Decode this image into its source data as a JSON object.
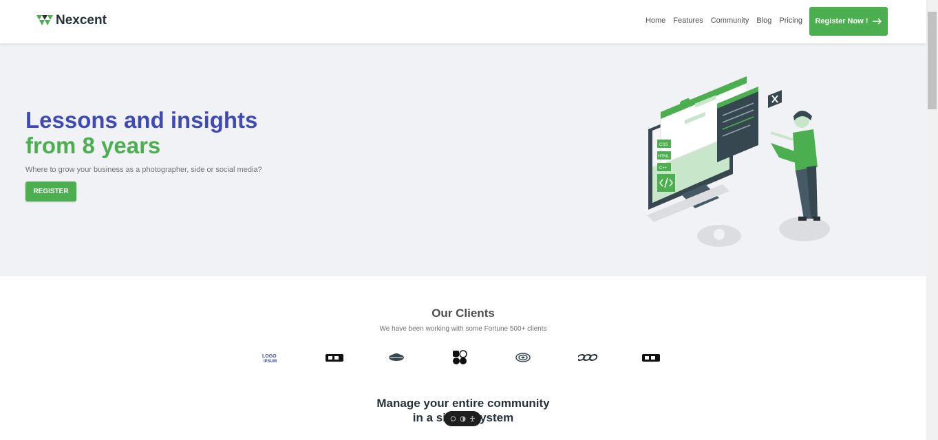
{
  "header": {
    "brand": "Nexcent",
    "nav": [
      {
        "label": "Home"
      },
      {
        "label": "Features"
      },
      {
        "label": "Community"
      },
      {
        "label": "Blog"
      },
      {
        "label": "Pricing"
      }
    ],
    "cta_label": "Register Now !"
  },
  "hero": {
    "title_line1": "Lessons and insights",
    "title_line2": "from 8 years",
    "subtitle": "Where to grow your business as a photographer, side or social media?",
    "button_label": "REGISTER",
    "illustration_tags": [
      "CSS",
      "HTML",
      "C++"
    ]
  },
  "clients": {
    "title": "Our Clients",
    "subtitle": "We have been working with some Fortune 500+ clients",
    "logos": [
      "client-logo-1",
      "client-logo-2",
      "client-logo-3",
      "client-logo-4",
      "client-logo-5",
      "client-logo-6",
      "client-logo-7"
    ]
  },
  "section": {
    "title_line1": "Manage your entire community",
    "title_line2": "in a single system"
  },
  "colors": {
    "primary_green": "#4caf4f",
    "primary_blue": "#3f4ab4",
    "hero_bg": "#f0f2f5",
    "dark_text": "#263238"
  }
}
